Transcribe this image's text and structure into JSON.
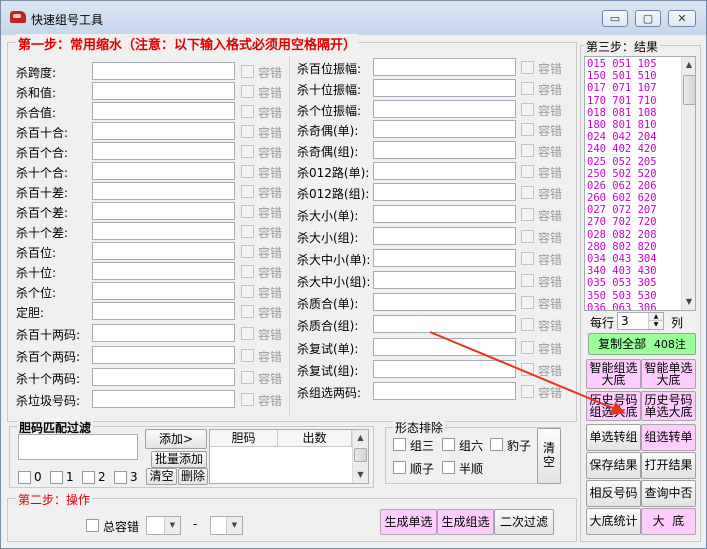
{
  "window": {
    "title": "快速组号工具",
    "minimize": "▭",
    "restore": "▢",
    "close": "✕"
  },
  "step1": {
    "title": "第一步：常用缩水（注意：以下输入格式必须用空格隔开）",
    "left_rows": [
      "杀跨度:",
      "杀和值:",
      "杀合值:",
      "杀百十合:",
      "杀百个合:",
      "杀十个合:",
      "杀百十差:",
      "杀百个差:",
      "杀十个差:",
      "杀百位:",
      "杀十位:",
      "杀个位:",
      "定胆:",
      "杀百十两码:",
      "杀百个两码:",
      "杀十个两码:",
      "杀垃圾号码:"
    ],
    "right_rows": [
      "杀百位振幅:",
      "杀十位振幅:",
      "杀个位振幅:",
      "杀奇偶(单):",
      "杀奇偶(组):",
      "杀012路(单):",
      "杀012路(组):",
      "杀大小(单):",
      "杀大小(组):",
      "杀大中小(单):",
      "杀大中小(组):",
      "杀质合(单):",
      "杀质合(组):",
      "杀复试(单):",
      "杀复试(组):",
      "杀组选两码:"
    ],
    "tolerance": "容错"
  },
  "dan_match": {
    "title": "胆码匹配过滤",
    "add": "添加>",
    "batch_add": "批量添加",
    "clear": "清空",
    "delete": "删除",
    "col_dan": "胆码",
    "col_count": "出数",
    "checks": [
      "0",
      "1",
      "2",
      "3"
    ]
  },
  "shape": {
    "title": "形态排除",
    "items": [
      "组三",
      "组六",
      "豹子",
      "顺子",
      "半顺"
    ],
    "clear": "清空"
  },
  "step2": {
    "title": "第二步：操作",
    "total_tolerance": "总容错",
    "dash": "-",
    "gen_single": "生成单选",
    "gen_group": "生成组选",
    "second_filter": "二次过滤"
  },
  "step3": {
    "title": "第三步：结果",
    "results": [
      "015  051  105",
      "150  501  510",
      "017  071  107",
      "170  701  710",
      "018  081  108",
      "180  801  810",
      "024  042  204",
      "240  402  420",
      "025  052  205",
      "250  502  520",
      "026  062  206",
      "260  602  620",
      "027  072  207",
      "270  702  720",
      "028  082  208",
      "280  802  820",
      "034  043  304",
      "340  403  430",
      "035  053  305",
      "350  503  530",
      "036  063  306"
    ],
    "per_row": "每行",
    "per_row_value": "3",
    "col": "列",
    "copy_all": "复制全部",
    "count": "408注",
    "buttons": [
      [
        "智能组选\n大底",
        "智能单选\n大底"
      ],
      [
        "历史号码\n组选大底",
        "历史号码\n单选大底"
      ],
      [
        "单选转组",
        "组选转单"
      ],
      [
        "保存结果",
        "打开结果"
      ],
      [
        "相反号码",
        "查询中否"
      ],
      [
        "大底统计",
        "大  底"
      ]
    ]
  },
  "colors": {
    "accent_red": "#e00000",
    "result_magenta": "#cc00cc",
    "pink_button": "#ffccff",
    "green_button": "#99ff99",
    "arrow": "#e8341c"
  }
}
